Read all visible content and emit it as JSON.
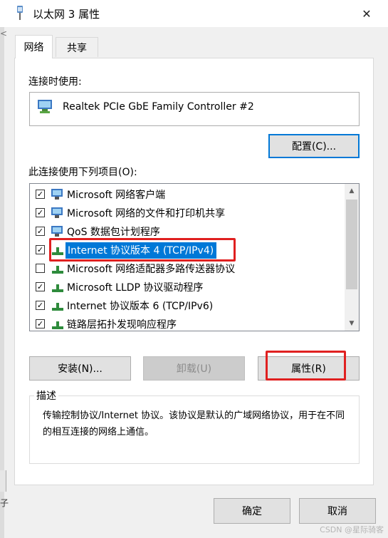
{
  "window": {
    "title": "以太网 3 属性",
    "close_glyph": "✕"
  },
  "tabs": [
    {
      "label": "网络",
      "active": true
    },
    {
      "label": "共享",
      "active": false
    }
  ],
  "connect_using": {
    "label": "连接时使用:",
    "adapter": "Realtek PCIe GbE Family Controller #2",
    "configure_button": "配置(C)..."
  },
  "items_label": "此连接使用下列项目(O):",
  "items": [
    {
      "label": "Microsoft 网络客户端",
      "checked": true,
      "icon": "network-client-icon"
    },
    {
      "label": "Microsoft 网络的文件和打印机共享",
      "checked": true,
      "icon": "network-client-icon"
    },
    {
      "label": "QoS 数据包计划程序",
      "checked": true,
      "icon": "network-client-icon"
    },
    {
      "label": "Internet 协议版本 4 (TCP/IPv4)",
      "checked": true,
      "icon": "protocol-icon",
      "selected": true
    },
    {
      "label": "Microsoft 网络适配器多路传送器协议",
      "checked": false,
      "icon": "protocol-icon"
    },
    {
      "label": "Microsoft LLDP 协议驱动程序",
      "checked": true,
      "icon": "protocol-icon"
    },
    {
      "label": "Internet 协议版本 6 (TCP/IPv6)",
      "checked": true,
      "icon": "protocol-icon"
    },
    {
      "label": "链路层拓扑发现响应程序",
      "checked": true,
      "icon": "protocol-icon"
    }
  ],
  "buttons": {
    "install": "安装(N)...",
    "uninstall": "卸载(U)",
    "properties": "属性(R)"
  },
  "description": {
    "legend": "描述",
    "text": "传输控制协议/Internet 协议。该协议是默认的广域网络协议，用于在不同的相互连接的网络上通信。"
  },
  "footer": {
    "ok": "确定",
    "cancel": "取消"
  },
  "background_fragments": {
    "top_left": "<",
    "bottom_left": "子"
  },
  "watermark": "CSDN @星际骑客",
  "colors": {
    "accent": "#0078d7",
    "highlight_box": "#e02020",
    "button_face": "#e1e1e1"
  }
}
